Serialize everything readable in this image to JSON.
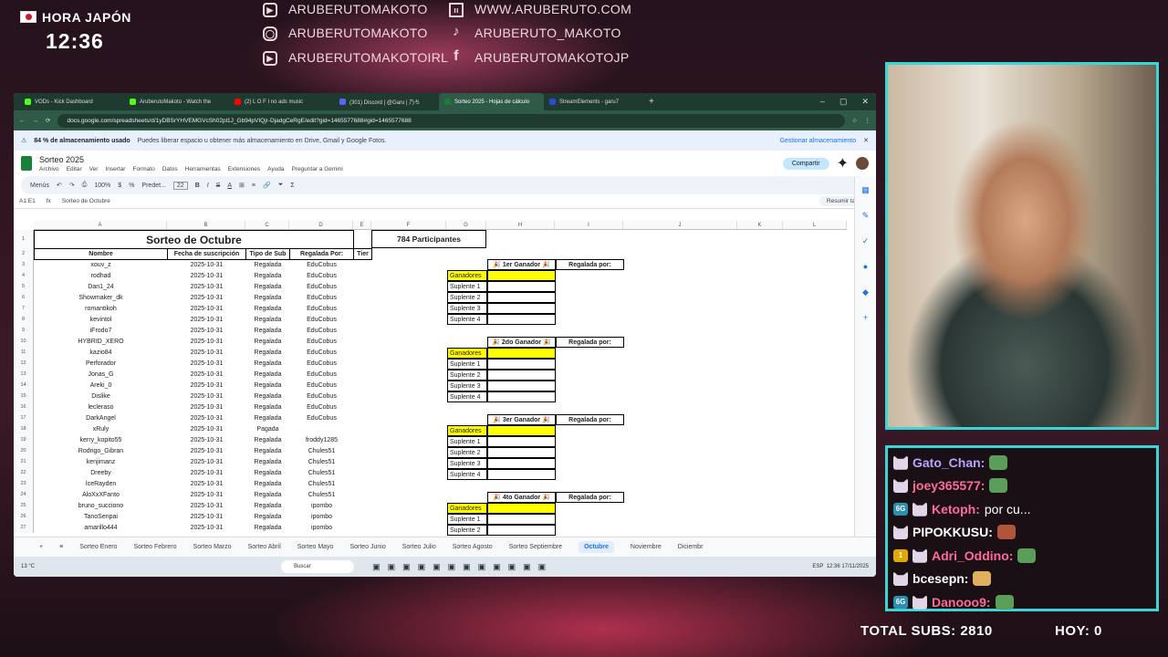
{
  "overlay": {
    "clock_label": "HORA JAPÓN",
    "clock_time": "12:36",
    "socials": [
      {
        "icon": "youtube-icon",
        "text": "ARUBERUTOMAKOTO"
      },
      {
        "icon": "instagram-icon",
        "text": "ARUBERUTOMAKOTO"
      },
      {
        "icon": "youtube-icon",
        "text": "ARUBERUTOMAKOTOIRL"
      },
      {
        "icon": "twitch-icon",
        "text": "WWW.ARUBERUTO.COM"
      },
      {
        "icon": "tiktok-icon",
        "text": "ARUBERUTO_MAKOTO"
      },
      {
        "icon": "facebook-icon",
        "text": "ARUBERUTOMAKOTOJP"
      }
    ],
    "total_subs": "TOTAL SUBS: 2810",
    "hoy": "HOY: 0",
    "accent": "#3ad6d6"
  },
  "browser": {
    "tabs": [
      {
        "label": "VODs - Kick Dashboard",
        "color": "#53fc18"
      },
      {
        "label": "AruberutoMakoto - Watch the",
        "color": "#53fc18"
      },
      {
        "label": "(2) L O F I no ads music",
        "color": "#ff0000"
      },
      {
        "label": "(301) Discord | @Garu | 乃ち",
        "color": "#5865f2"
      },
      {
        "label": "Sorteo 2025 - Hojas de cálculo",
        "color": "#188038",
        "active": true
      },
      {
        "label": "StreamElements - garu7",
        "color": "#2a4bd7"
      }
    ],
    "url": "docs.google.com/spreadsheets/d/1yDBSrYHVEMGVcSh02pl1J_Gb94pVIQjr-DjadgCeRgE/edit?gid=1465577688#gid=1465577688"
  },
  "sheets": {
    "banner_strong": "84 % de almacenamiento usado",
    "banner_text": "Puedes liberar espacio u obtener más almacenamiento en Drive, Gmail y Google Fotos.",
    "banner_action": "Gestionar almacenamiento",
    "doc_title": "Sorteo 2025",
    "menus": [
      "Archivo",
      "Editar",
      "Ver",
      "Insertar",
      "Formato",
      "Datos",
      "Herramientas",
      "Extensiones",
      "Ayuda",
      "Preguntar a Gemini"
    ],
    "share": "Compartir",
    "toolbar": {
      "menus": "Menús",
      "zoom": "100%",
      "font": "Predet...",
      "size": "22"
    },
    "cellref": "A1:E1",
    "formula": "Sorteo de Octubre",
    "summarize": "Resumir tabla",
    "columns": [
      "A",
      "B",
      "C",
      "D",
      "E",
      "F",
      "G",
      "H",
      "I",
      "J",
      "K",
      "L"
    ],
    "title": "Sorteo de Octubre",
    "participants": "784 Participantes",
    "headers": [
      "Nombre",
      "Fecha de suscripción",
      "Tipo de Sub",
      "Regalada Por:",
      "Tier"
    ],
    "rows": [
      [
        "xouv_z",
        "2025-10-31",
        "Regalada",
        "EduCobus"
      ],
      [
        "rodhad",
        "2025-10-31",
        "Regalada",
        "EduCobus"
      ],
      [
        "Dan1_24",
        "2025-10-31",
        "Regalada",
        "EduCobus"
      ],
      [
        "Showmaker_dk",
        "2025-10-31",
        "Regalada",
        "EduCobus"
      ],
      [
        "romantikoh",
        "2025-10-31",
        "Regalada",
        "EduCobus"
      ],
      [
        "kevintol",
        "2025-10-31",
        "Regalada",
        "EduCobus"
      ],
      [
        "iFrodo7",
        "2025-10-31",
        "Regalada",
        "EduCobus"
      ],
      [
        "HYBRID_XERO",
        "2025-10-31",
        "Regalada",
        "EduCobus"
      ],
      [
        "kazio84",
        "2025-10-31",
        "Regalada",
        "EduCobus"
      ],
      [
        "Perforador",
        "2025-10-31",
        "Regalada",
        "EduCobus"
      ],
      [
        "Jonas_G",
        "2025-10-31",
        "Regalada",
        "EduCobus"
      ],
      [
        "Areki_0",
        "2025-10-31",
        "Regalada",
        "EduCobus"
      ],
      [
        "Dislike",
        "2025-10-31",
        "Regalada",
        "EduCobus"
      ],
      [
        "lecleraso",
        "2025-10-31",
        "Regalada",
        "EduCobus"
      ],
      [
        "DarkAngel",
        "2025-10-31",
        "Regalada",
        "EduCobus"
      ],
      [
        "xRuly",
        "2025-10-31",
        "Pagada",
        ""
      ],
      [
        "kerry_kopito55",
        "2025-10-31",
        "Regalada",
        "froddy1285"
      ],
      [
        "Rodrigo_Gibran",
        "2025-10-31",
        "Regalada",
        "Chules51"
      ],
      [
        "kenjimanz",
        "2025-10-31",
        "Regalada",
        "Chules51"
      ],
      [
        "Dreeby",
        "2025-10-31",
        "Regalada",
        "Chules51"
      ],
      [
        "IceRayden",
        "2025-10-31",
        "Regalada",
        "Chules51"
      ],
      [
        "AloXxXFanto",
        "2025-10-31",
        "Regalada",
        "Chules51"
      ],
      [
        "bruno_succiono",
        "2025-10-31",
        "Regalada",
        "ipombo"
      ],
      [
        "TanoSenpai",
        "2025-10-31",
        "Regalada",
        "ipombo"
      ],
      [
        "amarillo444",
        "2025-10-31",
        "Regalada",
        "ipombo"
      ]
    ],
    "winner_blocks": [
      {
        "title": "🎉 1er Ganador 🎉",
        "by": "Regalada por:",
        "rows": [
          "Ganadores",
          "Suplente 1",
          "Suplente 2",
          "Suplente 3",
          "Suplente 4"
        ]
      },
      {
        "title": "🎉 2do Ganador 🎉",
        "by": "Regalada por:",
        "rows": [
          "Ganadores",
          "Suplente 1",
          "Suplente 2",
          "Suplente 3",
          "Suplente 4"
        ]
      },
      {
        "title": "🎉 3er Ganador 🎉",
        "by": "Regalada por:",
        "rows": [
          "Ganadores",
          "Suplente 1",
          "Suplente 2",
          "Suplente 3",
          "Suplente 4"
        ]
      },
      {
        "title": "🎉 4to Ganador 🎉",
        "by": "Regalada por:",
        "rows": [
          "Ganadores",
          "Suplente 1",
          "Suplente 2"
        ]
      }
    ],
    "sheet_tabs": [
      "Sorteo Enero",
      "Sorteo Febrero",
      "Sorteo Marzo",
      "Sorteo Abril",
      "Sorteo Mayo",
      "Sorteo Junio",
      "Sorteo Julio",
      "Sorteo Agosto",
      "Sorteo Septiembre",
      "Octubre",
      "Noviembre",
      "Diciembr"
    ],
    "active_tab": "Octubre"
  },
  "taskbar": {
    "weather": "13 °C",
    "search": "Buscar",
    "lang": "ESP",
    "time": "12:36",
    "date": "17/11/2025"
  },
  "chat": [
    {
      "user": "Gato_Chan:",
      "text": "",
      "badge": "",
      "color": "#b7a4ff"
    },
    {
      "user": "joey365577:",
      "text": "",
      "badge": "",
      "color": "#ff6a9a"
    },
    {
      "user": "Ketoph:",
      "text": "por cu...",
      "badge": "6G",
      "color": "#ff6a9a"
    },
    {
      "user": "PIPOKKUSU:",
      "text": "",
      "badge": "",
      "color": "#ffffff"
    },
    {
      "user": "Adri_Oddino:",
      "text": "",
      "badge": "1",
      "color": "#ff6a9a"
    },
    {
      "user": "bcesepn:",
      "text": "",
      "badge": "",
      "color": "#ffffff"
    },
    {
      "user": "Danooo9:",
      "text": "",
      "badge": "6G",
      "color": "#ff6a9a"
    }
  ]
}
